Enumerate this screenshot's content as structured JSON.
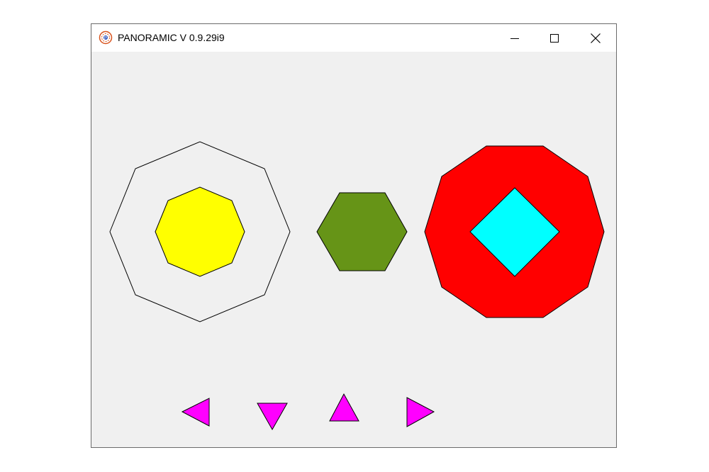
{
  "window": {
    "title": "PANORAMIC V 0.9.29i9",
    "icon": "panoramic-app-icon",
    "controls": [
      {
        "name": "minimize",
        "icon": "minimize-icon"
      },
      {
        "name": "maximize",
        "icon": "maximize-icon"
      },
      {
        "name": "close",
        "icon": "close-icon"
      }
    ]
  },
  "colors": {
    "client_background": "#f0f0f0",
    "octagon_outline": "#000000",
    "octagon_fill": "#ffff00",
    "hexagon_fill": "#669417",
    "decagon_fill": "#ff0000",
    "diamond_fill": "#00ffff",
    "arrow_fill": "#ff00ff"
  },
  "shapes": [
    {
      "name": "outer-octagon",
      "type": "octagon",
      "fill": "none"
    },
    {
      "name": "inner-octagon",
      "type": "octagon",
      "fill": "yellow"
    },
    {
      "name": "green-hexagon",
      "type": "hexagon",
      "fill": "green"
    },
    {
      "name": "red-decagon",
      "type": "decagon",
      "fill": "red"
    },
    {
      "name": "cyan-diamond",
      "type": "square",
      "fill": "cyan"
    }
  ],
  "arrows": [
    "left",
    "down",
    "up",
    "right"
  ]
}
